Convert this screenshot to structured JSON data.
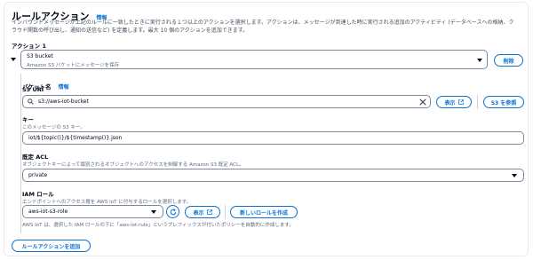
{
  "header": {
    "title": "ルールアクション",
    "info_link": "情報",
    "description": "インバウンドメッセージが上記のルールに一致したときに実行される１つ以上のアクションを選択します。アクションは、メッセージが到達した時に実行される追加のアクティビティ (データベースへの格納、クラウド関数の呼び出し、通知の送信など) を定義します。最大 10 個のアクションを追加できます。"
  },
  "action": {
    "heading": "アクション 1",
    "select_title": "S3 bucket",
    "select_subtitle": "Amazon S3 バケットにメッセージを保存",
    "remove_label": "削除"
  },
  "bucket": {
    "label": "バケット名",
    "info_link": "情報",
    "uri_label": "S3 URI",
    "value": "s3://aws-iot-bucket",
    "view_label": "表示",
    "browse_label": "S3 を参照"
  },
  "key": {
    "label": "キー",
    "description": "このメッセージの S3 キー。",
    "value": "iot/${topic()}/${timestamp()}.json"
  },
  "acl": {
    "label": "既定 ACL",
    "description": "オブジェクトキーによって識別されるオブジェクトへのアクセスを制御する Amazon S3 既定 ACL。",
    "value": "private"
  },
  "iam": {
    "label": "IAM ロール",
    "description": "エンドポイントへのアクセス権を AWS IoT に付与するロールを選択します。",
    "value": "aws-iot-s3-role",
    "view_label": "表示",
    "create_label": "新しいロールを作成",
    "note": "AWS IoT は、選択した IAM ロールの下に「aws-iot-rule」というプレフィックスが付いたポリシーを自動的に作成します。"
  },
  "footer": {
    "add_label": "ルールアクションを追加"
  },
  "colors": {
    "accent": "#0972d3",
    "text": "#000716",
    "muted": "#5f6b7a"
  },
  "icons": [
    "collapse-caret-icon",
    "dropdown-caret-icon",
    "search-icon",
    "clear-icon",
    "external-link-icon",
    "refresh-icon"
  ]
}
